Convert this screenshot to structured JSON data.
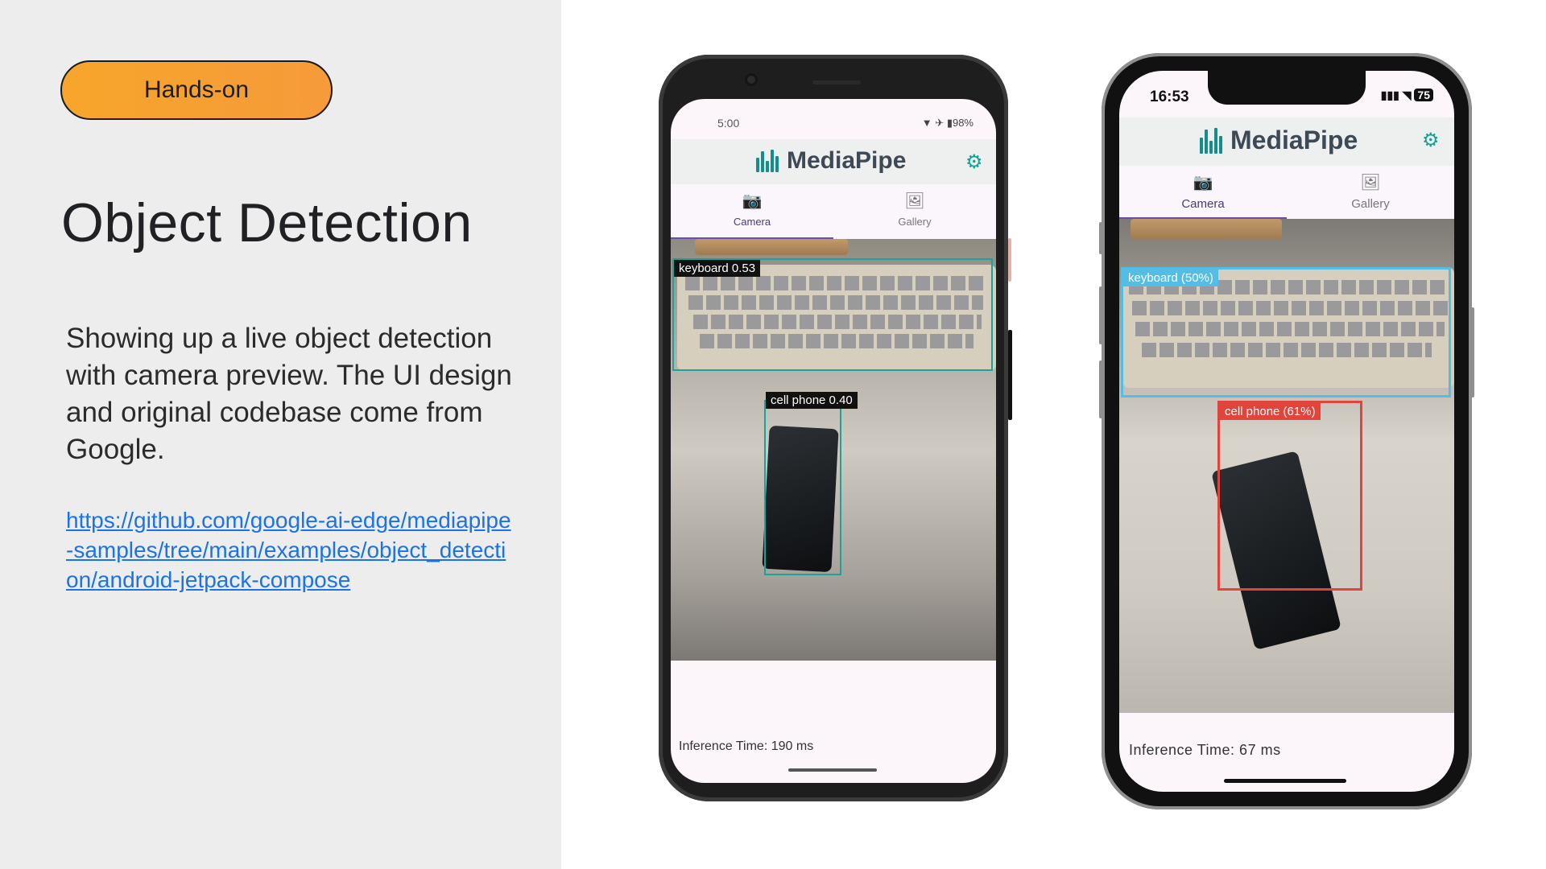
{
  "slide": {
    "badge": "Hands-on",
    "title": "Object Detection",
    "body": "Showing up a live object detection with camera preview. The UI design and original codebase come from Google.",
    "link": "https://github.com/google-ai-edge/mediapipe-samples/tree/main/examples/object_detection/android-jetpack-compose"
  },
  "android": {
    "status_time": "5:00",
    "status_battery": "98%",
    "app_title": "MediaPipe",
    "tabs": [
      "Camera",
      "Gallery"
    ],
    "detections": [
      {
        "label": "keyboard 0.53",
        "color": "#1aa39a"
      },
      {
        "label": "cell phone 0.40",
        "color": "#1aa39a"
      }
    ],
    "inference": "Inference Time: 190 ms"
  },
  "iphone": {
    "status_time": "16:53",
    "status_battery": "75",
    "app_title": "MediaPipe",
    "tabs": [
      "Camera",
      "Gallery"
    ],
    "detections": [
      {
        "label": "keyboard  (50%)",
        "color": "#54bde6"
      },
      {
        "label": "cell phone  (61%)",
        "color": "#e0443a"
      }
    ],
    "inference": "Inference Time: 67 ms"
  },
  "colors": {
    "accent": "#12a392",
    "tab_active": "#6c4ea6",
    "link": "#1a73e8"
  },
  "icons": {
    "settings": "gear-icon",
    "camera": "camera-icon",
    "gallery": "gallery-icon"
  }
}
